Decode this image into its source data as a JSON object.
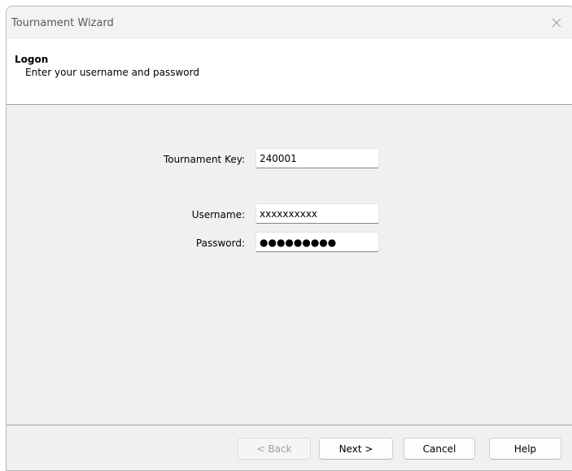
{
  "window": {
    "title": "Tournament Wizard"
  },
  "header": {
    "title": "Logon",
    "subtitle": "Enter your username and password"
  },
  "form": {
    "tournament_key": {
      "label": "Tournament Key:",
      "value": "240001"
    },
    "username": {
      "label": "Username:",
      "value": "xxxxxxxxxx"
    },
    "password": {
      "label": "Password:",
      "value": "●●●●●●●●●"
    }
  },
  "buttons": {
    "back": "< Back",
    "next": "Next >",
    "cancel": "Cancel",
    "help": "Help"
  },
  "icons": {
    "close": "close-icon"
  }
}
